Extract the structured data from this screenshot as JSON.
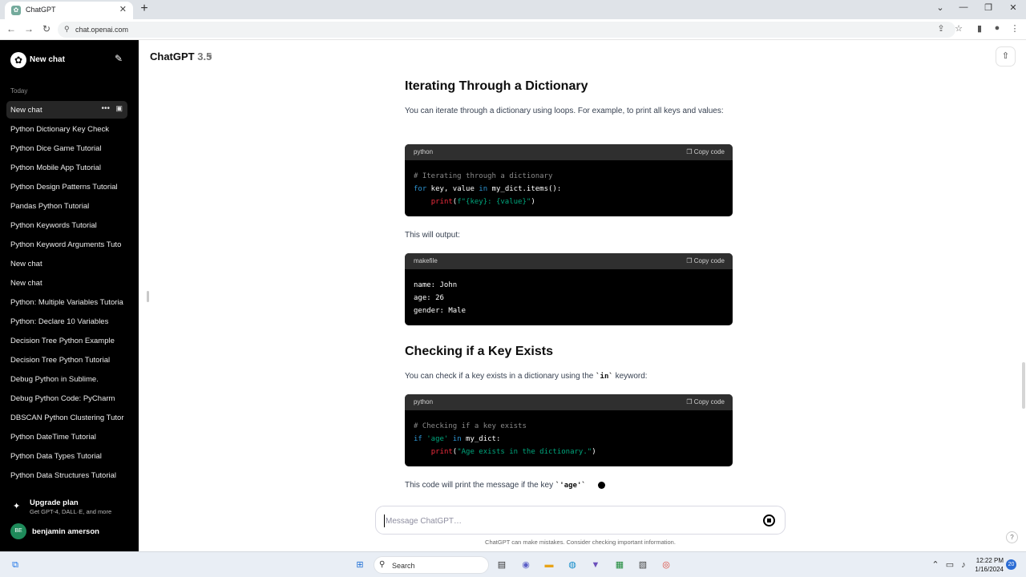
{
  "browser": {
    "tab_title": "ChatGPT",
    "tab_favicon": "openai-icon",
    "tab_close": "✕",
    "new_tab": "+",
    "url": "chat.openai.com",
    "window_controls": [
      "⌄",
      "—",
      "❐",
      "✕"
    ]
  },
  "sidebar": {
    "new_chat_label": "New chat",
    "section_label": "Today",
    "items": [
      {
        "label": "New chat",
        "active": true
      },
      {
        "label": "Python Dictionary Key Check"
      },
      {
        "label": "Python Dice Game Tutorial"
      },
      {
        "label": "Python Mobile App Tutorial"
      },
      {
        "label": "Python Design Patterns Tutorial"
      },
      {
        "label": "Pandas Python Tutorial"
      },
      {
        "label": "Python Keywords Tutorial"
      },
      {
        "label": "Python Keyword Arguments Tuto"
      },
      {
        "label": "New chat"
      },
      {
        "label": "New chat"
      },
      {
        "label": "Python: Multiple Variables Tutoria"
      },
      {
        "label": "Python: Declare 10 Variables"
      },
      {
        "label": "Decision Tree Python Example"
      },
      {
        "label": "Decision Tree Python Tutorial"
      },
      {
        "label": "Debug Python in Sublime."
      },
      {
        "label": "Debug Python Code: PyCharm"
      },
      {
        "label": "DBSCAN Python Clustering Tutor"
      },
      {
        "label": "Python DateTime Tutorial"
      },
      {
        "label": "Python Data Types Tutorial"
      },
      {
        "label": "Python Data Structures Tutorial"
      }
    ],
    "upgrade_title": "Upgrade plan",
    "upgrade_sub": "Get GPT-4, DALL·E, and more",
    "avatar_initials": "BE",
    "user_name": "benjamin amerson"
  },
  "header": {
    "model_name": "ChatGPT",
    "model_version": "3.5"
  },
  "content": {
    "heading1": "Iterating Through a Dictionary",
    "para1": "You can iterate through a dictionary using loops. For example, to print all keys and values:",
    "code1": {
      "lang": "python",
      "copy": "Copy code",
      "line1": "# Iterating through a dictionary",
      "line2_kw": "for",
      "line2_rest": " key, value ",
      "line2_in": "in",
      "line2_end": " my_dict.items():",
      "line3_fn": "print",
      "line3_paren": "(",
      "line3_str": "f\"{key}: {value}\"",
      "line3_close": ")"
    },
    "para2": "This will output:",
    "code2": {
      "lang": "makefile",
      "copy": "Copy code",
      "line1": "name: John",
      "line2": "age: 26",
      "line3": "gender: Male"
    },
    "heading2": "Checking if a Key Exists",
    "para3_pre": "You can check if a key exists in a dictionary using the ",
    "para3_code": "`in`",
    "para3_post": " keyword:",
    "code3": {
      "lang": "python",
      "copy": "Copy code",
      "line1": "# Checking if a key exists",
      "line2_kw": "if",
      "line2_str": " 'age' ",
      "line2_in": "in",
      "line2_end": " my_dict:",
      "line3_fn": "print",
      "line3_paren": "(",
      "line3_str": "\"Age exists in the dictionary.\"",
      "line3_close": ")"
    },
    "para4_pre": "This code will print the message if the key ",
    "para4_code": "`'age'`"
  },
  "composer": {
    "placeholder": "Message ChatGPT…",
    "disclaimer": "ChatGPT can make mistakes. Consider checking important information."
  },
  "taskbar": {
    "search_label": "Search",
    "time": "12:22 PM",
    "date": "1/16/2024",
    "notification_count": "20"
  },
  "colors": {
    "sidebar_bg": "#000000",
    "code_bg": "#000000",
    "code_header_bg": "#2f2f2f",
    "keyword": "#2e95d3",
    "string": "#00a67d",
    "function": "#f22c3d"
  }
}
